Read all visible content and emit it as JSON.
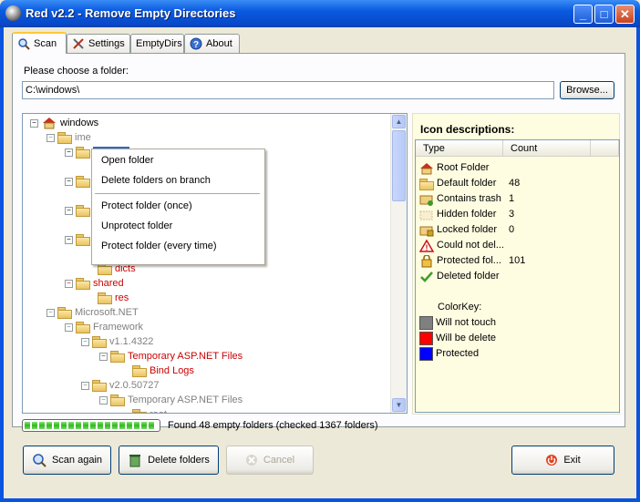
{
  "window": {
    "title": "Red v2.2 - Remove Empty Directories",
    "minimize": "_",
    "maximize": "□",
    "close": "✕"
  },
  "tabs": [
    {
      "label": "Scan",
      "icon": "magnifier-icon",
      "active": true
    },
    {
      "label": "Settings",
      "icon": "tools-icon"
    },
    {
      "label": "EmptyDirs"
    },
    {
      "label": "About",
      "icon": "help-icon"
    }
  ],
  "folder_label": "Please choose a folder:",
  "folder_path": "C:\\windows\\",
  "browse_label": "Browse...",
  "tree": [
    {
      "label": "windows",
      "color": "#000000",
      "root": true
    },
    {
      "label": "ime",
      "color": "#808080"
    },
    {
      "label": "dicts",
      "color": "#cc0000"
    },
    {
      "label": "shared",
      "color": "#cc0000"
    },
    {
      "label": "res",
      "color": "#cc0000"
    },
    {
      "label": "Microsoft.NET",
      "color": "#808080"
    },
    {
      "label": "Framework",
      "color": "#808080"
    },
    {
      "label": "v1.1.4322",
      "color": "#808080"
    },
    {
      "label": "Temporary ASP.NET Files",
      "color": "#cc0000"
    },
    {
      "label": "Bind Logs",
      "color": "#cc0000"
    },
    {
      "label": "v2.0.50727",
      "color": "#808080"
    },
    {
      "label": "Temporary ASP.NET Files",
      "color": "#808080"
    },
    {
      "label": "root",
      "color": "#808080"
    }
  ],
  "context_menu": {
    "items": [
      "Open folder",
      "Delete folders on branch",
      "Protect folder (once)",
      "Unprotect folder",
      "Protect folder (every time)"
    ]
  },
  "icon_panel": {
    "title": "Icon descriptions:",
    "col_type": "Type",
    "col_count": "Count",
    "rows": [
      {
        "icon": "root-folder-icon",
        "label": "Root Folder",
        "count": ""
      },
      {
        "icon": "default-folder-icon",
        "label": "Default folder",
        "count": "48"
      },
      {
        "icon": "trash-folder-icon",
        "label": "Contains trash",
        "count": "1"
      },
      {
        "icon": "hidden-folder-icon",
        "label": "Hidden folder",
        "count": "3"
      },
      {
        "icon": "locked-folder-icon",
        "label": "Locked folder",
        "count": "0"
      },
      {
        "icon": "warning-icon",
        "label": "Could not del...",
        "count": ""
      },
      {
        "icon": "protected-folder-icon",
        "label": "Protected fol...",
        "count": "101"
      },
      {
        "icon": "checkmark-icon",
        "label": "Deleted folder",
        "count": ""
      }
    ],
    "colorkey_title": "ColorKey:",
    "colorkey": [
      {
        "label": "Will not touch",
        "color": "#808080"
      },
      {
        "label": "Will be delete",
        "color": "#ff0000"
      },
      {
        "label": "Protected",
        "color": "#0000ff"
      }
    ]
  },
  "progress": {
    "value": 1.0
  },
  "status_text": "Found 48 empty folders (checked 1367 folders)",
  "buttons": {
    "scan_again": "Scan again",
    "delete_folders": "Delete folders",
    "cancel": "Cancel",
    "exit": "Exit"
  }
}
